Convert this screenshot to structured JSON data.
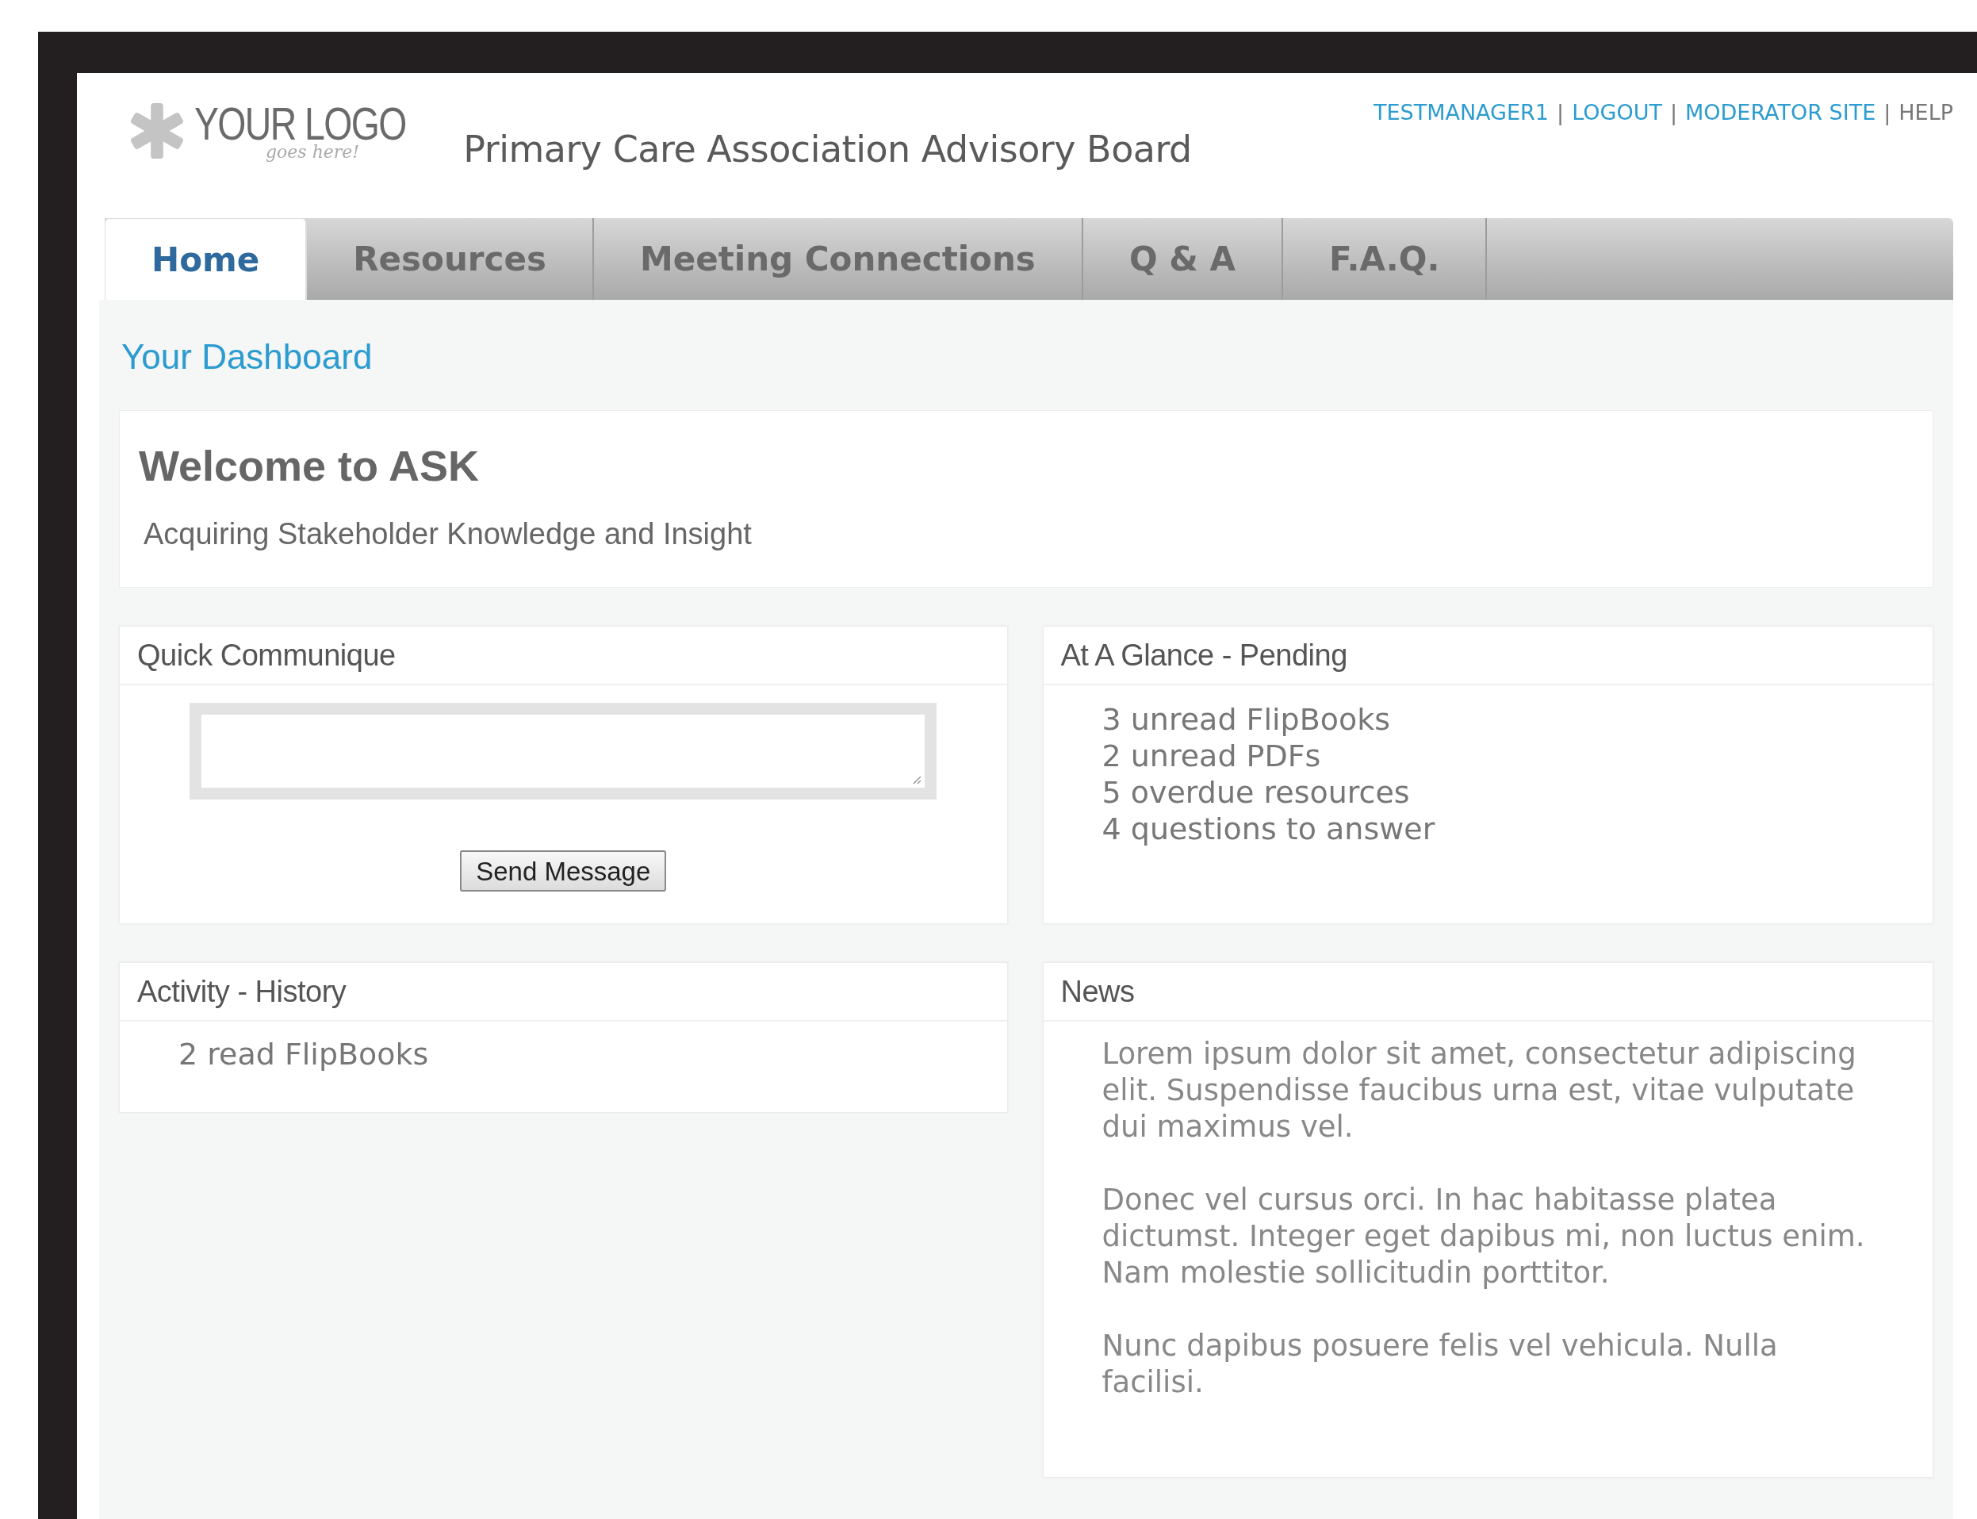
{
  "logo": {
    "text": "YOUR LOGO",
    "tagline": "goes here!"
  },
  "site_title": "Primary Care Association Advisory Board",
  "user_links": {
    "separator": "|",
    "items": [
      "TESTMANAGER1",
      "LOGOUT",
      "MODERATOR SITE",
      "HELP"
    ]
  },
  "tabs": [
    {
      "label": "Home",
      "selected": true
    },
    {
      "label": "Resources",
      "selected": false
    },
    {
      "label": "Meeting Connections",
      "selected": false
    },
    {
      "label": "Q & A",
      "selected": false
    },
    {
      "label": "F.A.Q.",
      "selected": false
    }
  ],
  "dashboard_title": "Your Dashboard",
  "welcome": {
    "title": "Welcome to ASK",
    "subtitle": "Acquiring Stakeholder Knowledge and Insight"
  },
  "quick_communique": {
    "title": "Quick Communique",
    "button": "Send Message"
  },
  "at_a_glance": {
    "title": "At A Glance - Pending",
    "items": [
      "3 unread FlipBooks",
      "2 unread PDFs",
      "5 overdue resources",
      "4 questions to answer"
    ]
  },
  "activity": {
    "title": "Activity - History",
    "items": [
      "2 read FlipBooks"
    ]
  },
  "news": {
    "title": "News",
    "paragraphs": [
      "Lorem ipsum dolor sit amet, consectetur adipiscing elit. Suspendisse faucibus urna est, vitae vulputate dui maximus vel.",
      "Donec vel cursus orci. In hac habitasse platea dictumst. Integer eget dapibus mi, non luctus enim. Nam molestie sollicitudin porttitor.",
      "Nunc dapibus posuere felis vel vehicula. Nulla facilisi."
    ]
  }
}
